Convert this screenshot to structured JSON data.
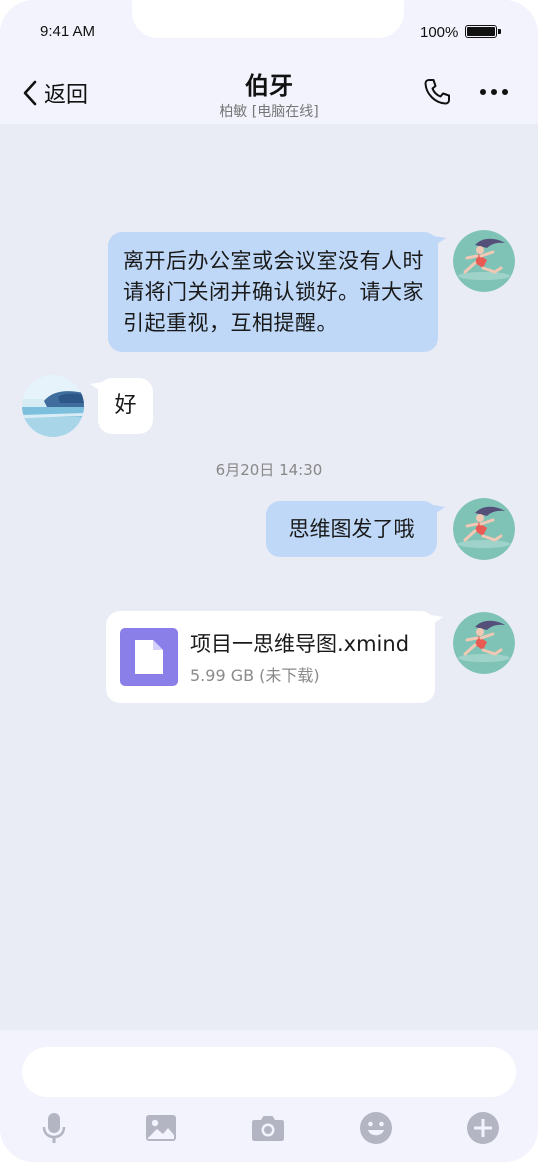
{
  "status_bar": {
    "time": "9:41 AM",
    "battery": "100%"
  },
  "header": {
    "back_label": "返回",
    "title": "伯牙",
    "subtitle": "柏敏 [电脑在线]"
  },
  "messages": [
    {
      "side": "right",
      "text": "离开后办公室或会议室没有人时请将门关闭并确认锁好。请大家引起重视，互相提醒。"
    },
    {
      "side": "left",
      "text": "好"
    },
    {
      "timestamp": "6月20日 14:30"
    },
    {
      "side": "right",
      "text": "思维图发了哦"
    },
    {
      "side": "right",
      "file": {
        "name": "项目一思维导图.xmind",
        "size": "5.99 GB (未下载)"
      }
    }
  ],
  "composer": {
    "placeholder": ""
  },
  "toolbar": [
    "microphone-icon",
    "image-icon",
    "camera-icon",
    "emoji-icon",
    "plus-icon"
  ],
  "colors": {
    "accent": "#bfd8f7",
    "file_icon": "#8a7ee8",
    "background": "#e9ebf5"
  }
}
